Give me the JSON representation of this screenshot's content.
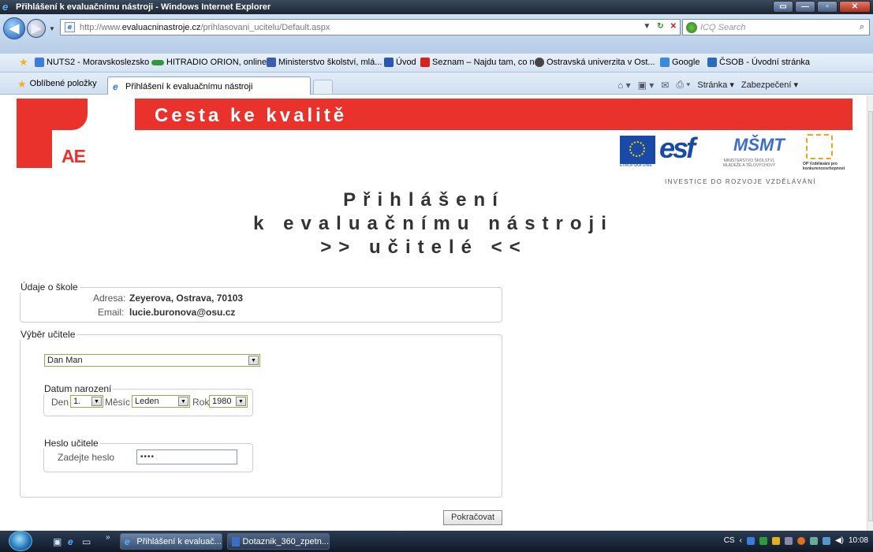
{
  "window": {
    "title": "Přihlášení k evaluačnímu nástroji - Windows Internet Explorer"
  },
  "address": {
    "url_prefix": "http://www.",
    "url_domain": "evaluacninastroje.cz",
    "url_path": "/prihlasovani_ucitelu/Default.aspx",
    "search_placeholder": "ICQ Search"
  },
  "links": [
    {
      "label": "NUTS2 - Moravskoslezsko",
      "color": "#3b7dd8"
    },
    {
      "label": "HITRADIO ORION, online ...",
      "color": "#2e9a3c"
    },
    {
      "label": "Ministerstvo školství, mlá...",
      "color": "#3b5fb0"
    },
    {
      "label": "Úvod",
      "color": "#2a56b8"
    },
    {
      "label": "Seznam – Najdu tam, co n...",
      "color": "#d8221c"
    },
    {
      "label": "Ostravská univerzita v Ost...",
      "color": "#444444"
    },
    {
      "label": "Google",
      "color": "#3a8ae0"
    },
    {
      "label": "ČSOB - Úvodní stránka",
      "color": "#2a6bc0"
    }
  ],
  "toolbar": {
    "favorites_label": "Oblíbené položky",
    "tab_label": "Přihlášení k evaluačnímu nástroji",
    "page_menu": "Stránka",
    "safety_menu": "Zabezpečení"
  },
  "banner": {
    "title": "Cesta ke kvalitě",
    "logo_text": "AE",
    "eu_caption": "EVROPSKÁ UNIE",
    "esf_text": "esf",
    "msmt_text": "MŠMT",
    "msmt_caption": "MINISTERSTVO ŠKOLSTVÍ, MLÁDEŽE A TĚLOVÝCHOVY",
    "op_caption": "OP Vzdělávání pro konkurenceschopnost",
    "tagline": "INVESTICE DO ROZVOJE VZDĚLÁVÁNÍ"
  },
  "heading": {
    "line1": "Přihlášení",
    "line2": "k evaluačnímu nástroji",
    "line3": ">> učitelé <<"
  },
  "school": {
    "legend": "Údaje o škole",
    "address_label": "Adresa:",
    "address_value": "Zeyerova, Ostrava, 70103",
    "email_label": "Email:",
    "email_value": "lucie.buronova@osu.cz"
  },
  "teacher": {
    "legend": "Výběr učitele",
    "selected_teacher": "Dan Man",
    "birth_legend": "Datum narození",
    "day_label": "Den",
    "day_value": "1.",
    "month_label": "Měsíc",
    "month_value": "Leden",
    "year_label": "Rok",
    "year_value": "1980",
    "password_legend": "Heslo učitele",
    "password_label": "Zadejte heslo",
    "password_value": "••••"
  },
  "form": {
    "submit_label": "Pokračovat"
  },
  "taskbar": {
    "tasks": [
      "Přihlášení k evaluač...",
      "Dotaznik_360_zpetn..."
    ],
    "language": "CS",
    "clock": "10:08"
  }
}
